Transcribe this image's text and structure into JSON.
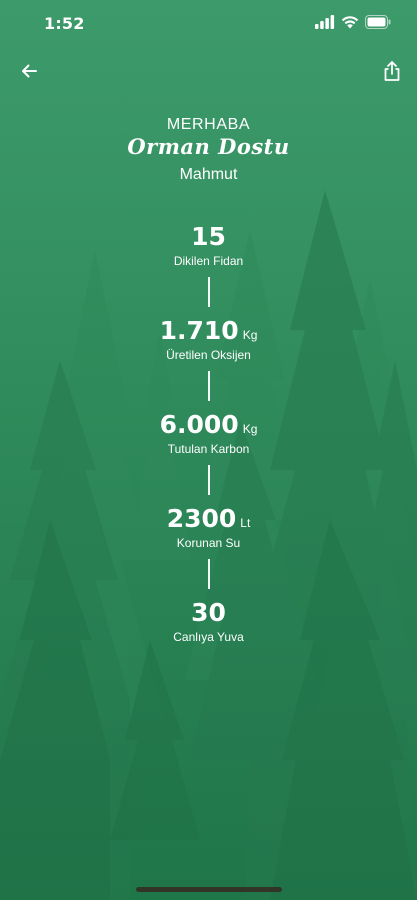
{
  "status_bar": {
    "time": "1:52"
  },
  "nav": {
    "back_icon": "arrow-left-icon",
    "share_icon": "share-icon"
  },
  "greeting": {
    "hello": "MERHABA",
    "title": "Orman Dostu",
    "name": "Mahmut"
  },
  "stats": [
    {
      "value": "15",
      "unit": "",
      "label": "Dikilen Fidan"
    },
    {
      "value": "1.710",
      "unit": "Kg",
      "label": "Üretilen Oksijen"
    },
    {
      "value": "6.000",
      "unit": "Kg",
      "label": "Tutulan Karbon"
    },
    {
      "value": "2300",
      "unit": "Lt",
      "label": "Korunan Su"
    },
    {
      "value": "30",
      "unit": "",
      "label": "Canlıya Yuva"
    }
  ],
  "colors": {
    "background_top": "#3d9a6a",
    "background_bottom": "#20794b",
    "text": "#ffffff"
  }
}
